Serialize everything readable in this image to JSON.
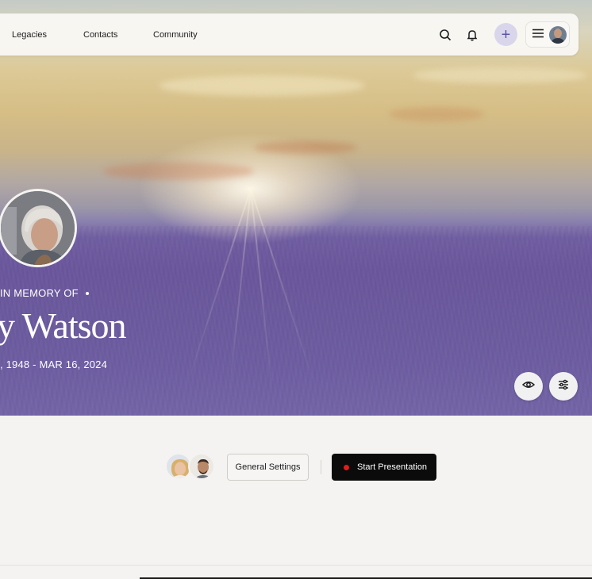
{
  "nav": {
    "links": [
      "Legacies",
      "Contacts",
      "Community"
    ],
    "add_symbol": "+"
  },
  "memorial": {
    "prefix": "IN MEMORY OF",
    "name": "y Watson",
    "dates": ", 1948 - MAR 16, 2024"
  },
  "toolbar": {
    "settings_label": "General Settings",
    "present_label": "Start Presentation"
  },
  "colors": {
    "accent_purple": "#5b54a0",
    "add_button_bg": "#d9d6ec",
    "record_dot": "#e21b1b",
    "primary_button": "#0b0b0b"
  },
  "icons": {
    "search": "search-icon",
    "bell": "bell-icon",
    "add": "plus-icon",
    "menu": "hamburger-icon",
    "preview": "eye-icon",
    "adjust": "sliders-icon"
  }
}
